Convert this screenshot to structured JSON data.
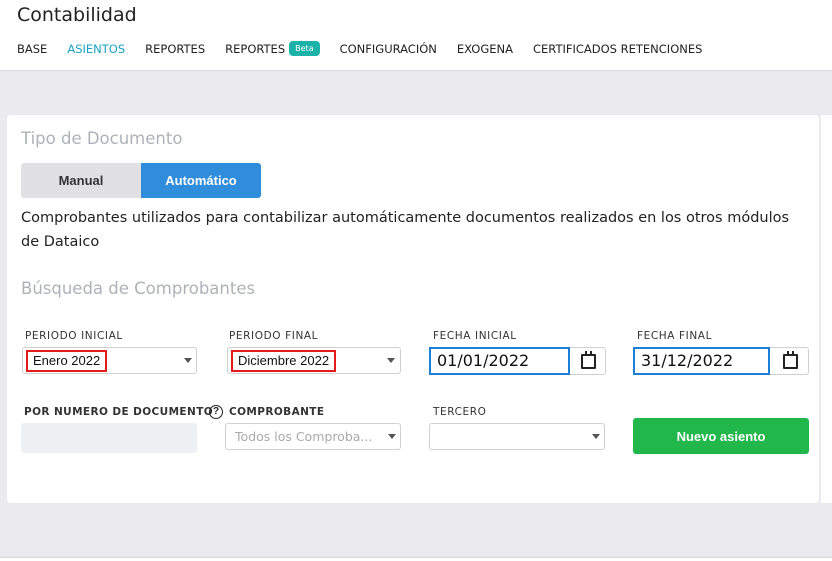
{
  "app": {
    "title": "Contabilidad"
  },
  "nav": {
    "items": [
      {
        "label": "BASE"
      },
      {
        "label": "ASIENTOS"
      },
      {
        "label": "REPORTES"
      },
      {
        "label": "REPORTES",
        "badge": "Beta"
      },
      {
        "label": "CONFIGURACIÓN"
      },
      {
        "label": "EXOGENA"
      },
      {
        "label": "CERTIFICADOS RETENCIONES"
      }
    ],
    "active_index": 1
  },
  "doc_type": {
    "title": "Tipo de Documento",
    "options": [
      "Manual",
      "Automático"
    ],
    "selected": "Automático",
    "description": "Comprobantes utilizados para contabilizar automáticamente documentos realizados en los otros módulos de Dataico"
  },
  "search": {
    "title": "Búsqueda de Comprobantes",
    "periodo_inicial": {
      "label": "PERIODO INICIAL",
      "value": "Enero 2022"
    },
    "periodo_final": {
      "label": "PERIODO FINAL",
      "value": "Diciembre 2022"
    },
    "fecha_inicial": {
      "label": "FECHA INICIAL",
      "value": "01/01/2022"
    },
    "fecha_final": {
      "label": "FECHA FINAL",
      "value": "31/12/2022"
    },
    "numero_documento": {
      "label": "POR NUMERO DE DOCUMENTO",
      "value": ""
    },
    "comprobante": {
      "label": "COMPROBANTE",
      "placeholder": "Todos los Comproba..."
    },
    "tercero": {
      "label": "TERCERO",
      "value": ""
    },
    "new_button": "Nuevo asiento"
  },
  "colors": {
    "accent_blue": "#2f8ddc",
    "active_nav": "#1aa3c4",
    "beta_badge": "#1bb3a8",
    "primary_green": "#21b74b",
    "highlight_red": "#e41b1b",
    "date_border_blue": "#1b7fd6"
  }
}
